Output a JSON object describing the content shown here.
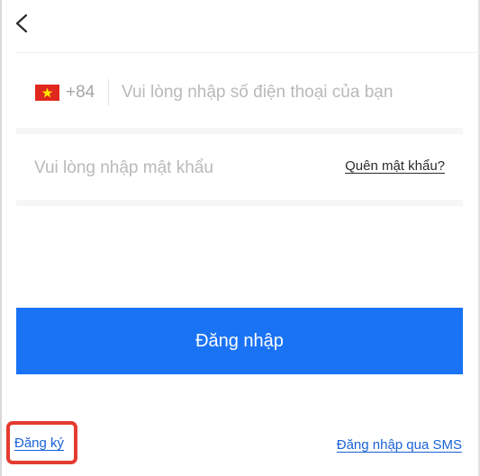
{
  "header": {
    "back_icon": "chevron-left-icon"
  },
  "phone_field": {
    "flag_icon": "vietnam-flag-icon",
    "country_code": "+84",
    "placeholder": "Vui lòng nhập số điện thoại của bạn",
    "value": ""
  },
  "password_field": {
    "placeholder": "Vui lòng nhập mật khẩu",
    "value": "",
    "forgot_label": "Quên mật khẩu?"
  },
  "login_button": {
    "label": "Đăng nhập",
    "color": "#1a73f5"
  },
  "footer": {
    "register_label": "Đăng ký",
    "sms_login_label": "Đăng nhập qua SMS",
    "link_color": "#1a62d6",
    "highlight_color": "#e53b30"
  }
}
